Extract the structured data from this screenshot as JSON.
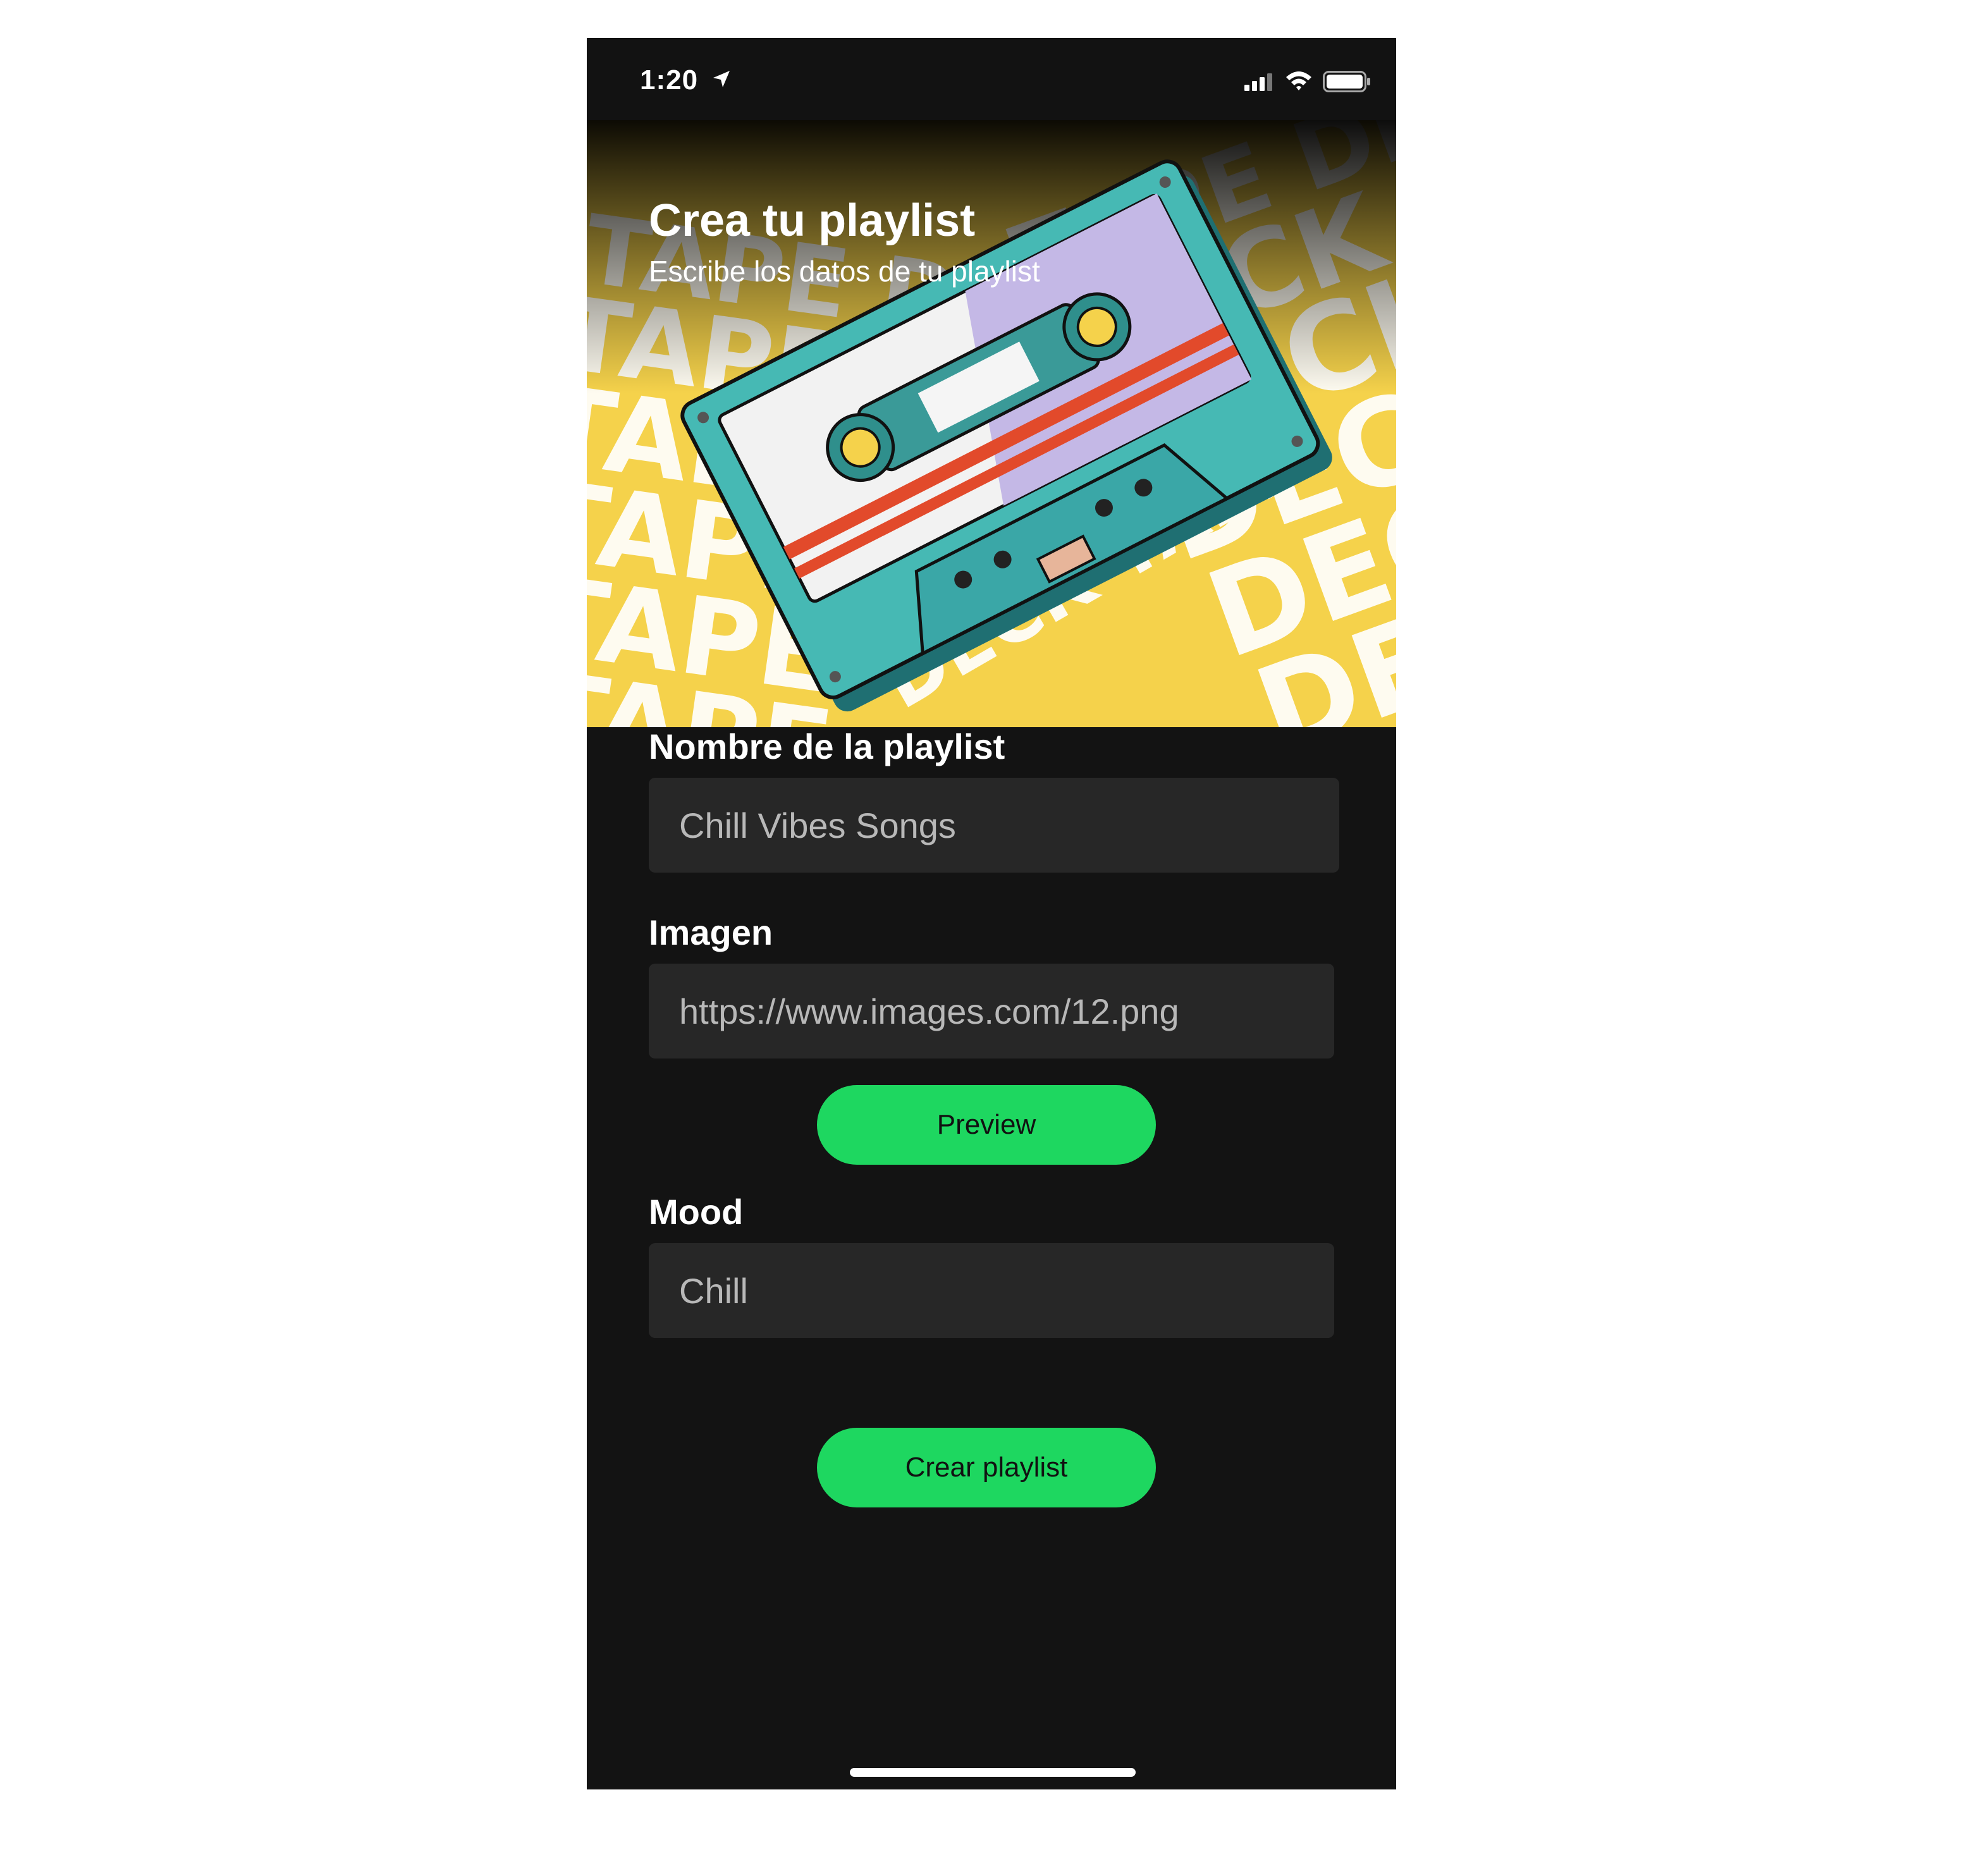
{
  "status_bar": {
    "time": "1:20",
    "icons": [
      "location-arrow-icon",
      "cellular-signal-icon",
      "wifi-icon",
      "battery-icon"
    ]
  },
  "header": {
    "title": "Crea tu playlist",
    "subtitle": "Escribe los datos de tu playlist",
    "background_words": [
      "TAPE",
      "DECK"
    ],
    "art": "cassette-tape-illustration"
  },
  "form": {
    "name": {
      "label": "Nombre de la playlist",
      "placeholder": "Chill Vibes Songs"
    },
    "image": {
      "label": "Imagen",
      "placeholder": "https://www.images.com/12.png"
    },
    "preview_button": "Preview",
    "mood": {
      "label": "Mood",
      "placeholder": "Chill"
    },
    "submit_button": "Crear playlist"
  },
  "colors": {
    "background": "#131313",
    "field": "#272727",
    "accent": "#1ed760",
    "hero_yellow": "#f5d24b",
    "cassette_teal": "#3aa7a7"
  }
}
